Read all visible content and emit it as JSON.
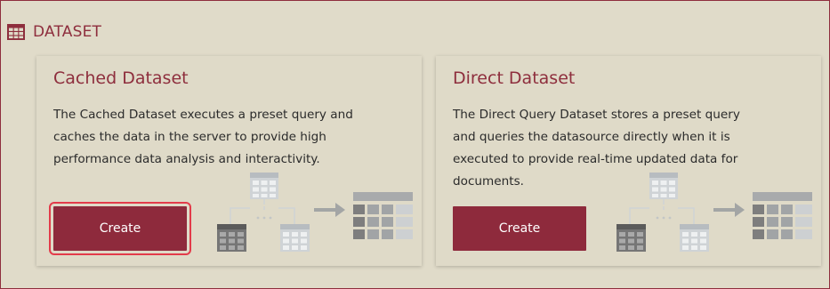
{
  "section": {
    "title": "DATASET",
    "icon": "table-grid-icon"
  },
  "cards": [
    {
      "title": "Cached Dataset",
      "description": "The Cached Dataset executes a preset query and caches the data in the server to provide high performance data analysis and interactivity.",
      "button_label": "Create",
      "button_focused": true,
      "illustration": "dataset-flow-illustration"
    },
    {
      "title": "Direct Dataset",
      "description": "The Direct Query Dataset stores a preset query and queries the datasource directly when it is executed to provide real-time updated data for documents.",
      "button_label": "Create",
      "button_focused": false,
      "illustration": "dataset-flow-illustration"
    }
  ],
  "colors": {
    "background": "#e0dbc9",
    "accent": "#8e2e3d",
    "button": "#8e2a3c",
    "focus_ring": "#e33b4a"
  }
}
